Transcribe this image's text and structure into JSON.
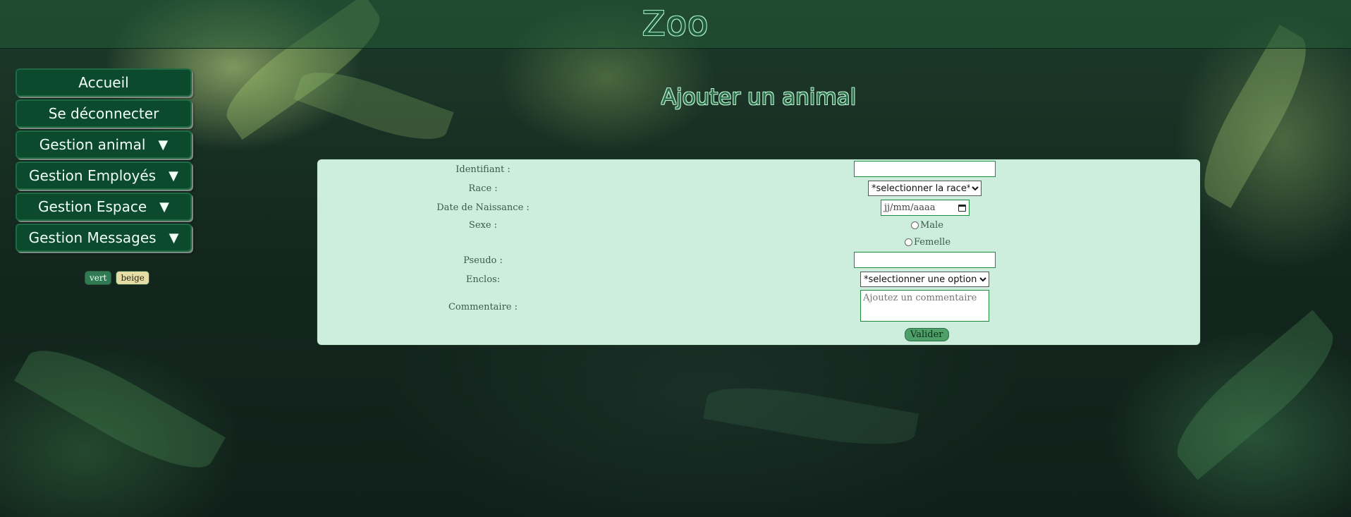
{
  "header": {
    "logo": "Zoo"
  },
  "sidebar": {
    "items": [
      {
        "label": "Accueil",
        "arrow": ""
      },
      {
        "label": "Se déconnecter",
        "arrow": ""
      },
      {
        "label": "Gestion animal",
        "arrow": "▼"
      },
      {
        "label": "Gestion Employés",
        "arrow": "▼"
      },
      {
        "label": "Gestion Espace",
        "arrow": "▼"
      },
      {
        "label": "Gestion Messages",
        "arrow": "▼"
      }
    ],
    "themes": {
      "vert": "vert",
      "beige": "beige"
    }
  },
  "main": {
    "title": "Ajouter un animal",
    "form": {
      "identifiant_label": "Identifiant :",
      "identifiant_value": "",
      "race_label": "Race :",
      "race_selected": "*selectionner la race*",
      "naissance_label": "Date de Naissance :",
      "naissance_placeholder": "jj/mm/aaaa",
      "sexe_label": "Sexe :",
      "sexe_male": "Male",
      "sexe_femelle": "Femelle",
      "pseudo_label": "Pseudo :",
      "pseudo_value": "",
      "enclos_label": "Enclos:",
      "enclos_selected": "*selectionner une option*",
      "commentaire_label": "Commentaire :",
      "commentaire_placeholder": "Ajoutez un commentaire",
      "submit_label": "Valider"
    }
  },
  "colors": {
    "nav_bg": "#0b4a2c",
    "panel_bg": "#cdeedd",
    "accent_green": "#2b6f49",
    "beige": "#e6dca6"
  }
}
